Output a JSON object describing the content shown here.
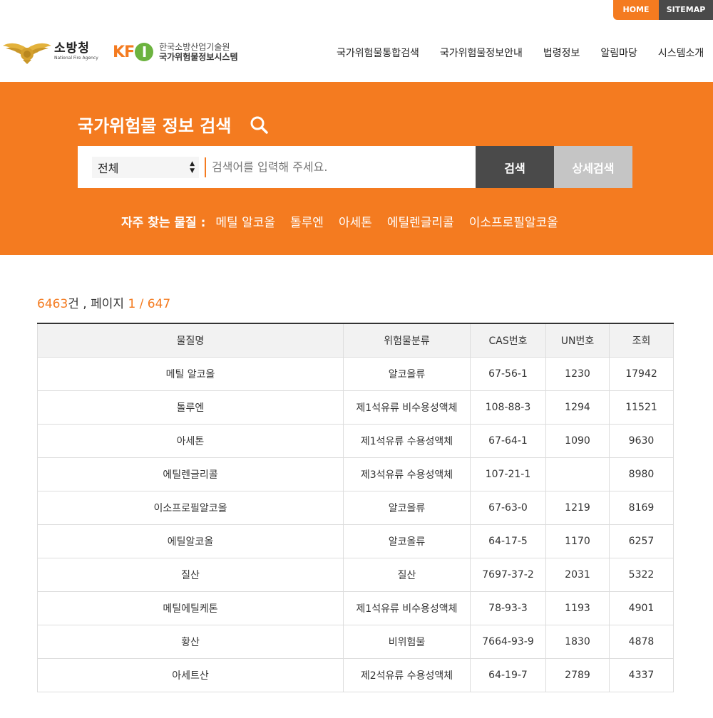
{
  "utility": {
    "home": "HOME",
    "sitemap": "SITEMAP"
  },
  "logos": {
    "agency_kr": "소방청",
    "agency_en": "National Fire Agency",
    "kfi_mark_k": "K",
    "kfi_mark_f": "F",
    "kfi_mark_i": "I",
    "kfi_line1": "한국소방산업기술원",
    "kfi_line2": "국가위험물정보시스템"
  },
  "nav": [
    "국가위험물통합검색",
    "국가위험물정보안내",
    "법령정보",
    "알림마당",
    "시스템소개"
  ],
  "search": {
    "title": "국가위험물 정보 검색",
    "select_value": "전체",
    "placeholder": "검색어를 입력해 주세요.",
    "search_button": "검색",
    "detail_button": "상세검색",
    "frequent_label": "자주 찾는 물질 :",
    "frequent": [
      "메틸 알코올",
      "톨루엔",
      "아세톤",
      "에틸렌글리콜",
      "이소프로필알코올"
    ]
  },
  "summary": {
    "count": "6463",
    "count_unit": "건 , 페이지 ",
    "page": "1 / 647"
  },
  "table": {
    "headers": [
      "물질명",
      "위험물분류",
      "CAS번호",
      "UN번호",
      "조회"
    ],
    "rows": [
      [
        "메틸 알코올",
        "알코올류",
        "67-56-1",
        "1230",
        "17942"
      ],
      [
        "톨루엔",
        "제1석유류 비수용성액체",
        "108-88-3",
        "1294",
        "11521"
      ],
      [
        "아세톤",
        "제1석유류 수용성액체",
        "67-64-1",
        "1090",
        "9630"
      ],
      [
        "에틸렌글리콜",
        "제3석유류 수용성액체",
        "107-21-1",
        "",
        "8980"
      ],
      [
        "이소프로필알코올",
        "알코올류",
        "67-63-0",
        "1219",
        "8169"
      ],
      [
        "에틸알코올",
        "알코올류",
        "64-17-5",
        "1170",
        "6257"
      ],
      [
        "질산",
        "질산",
        "7697-37-2",
        "2031",
        "5322"
      ],
      [
        "메틸에틸케톤",
        "제1석유류 비수용성액체",
        "78-93-3",
        "1193",
        "4901"
      ],
      [
        "황산",
        "비위험물",
        "7664-93-9",
        "1830",
        "4878"
      ],
      [
        "아세트산",
        "제2석유류 수용성액체",
        "64-19-7",
        "2789",
        "4337"
      ]
    ]
  },
  "colors": {
    "accent": "#f47b20",
    "dark": "#4a4a4a",
    "muted": "#c5c5c5"
  }
}
